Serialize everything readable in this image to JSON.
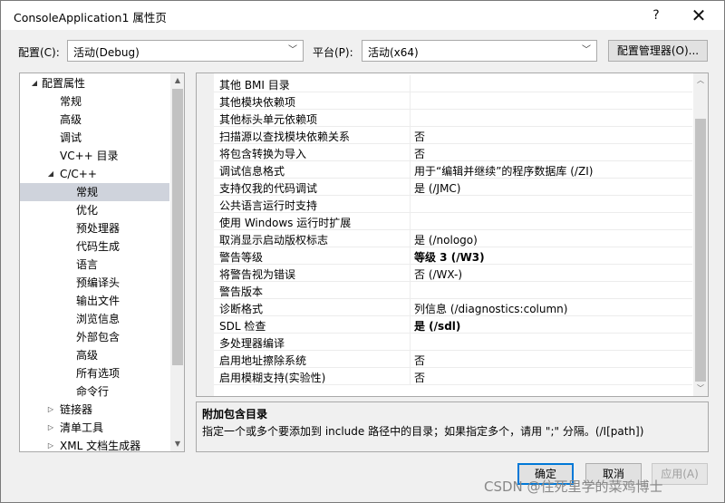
{
  "window": {
    "title": "ConsoleApplication1 属性页",
    "help": "?",
    "close": "✕"
  },
  "config": {
    "label": "配置(C):",
    "value": "活动(Debug)",
    "platform_label": "平台(P):",
    "platform_value": "活动(x64)",
    "manager_button": "配置管理器(O)..."
  },
  "tree": {
    "items": [
      {
        "label": "配置属性",
        "toggle": "◢"
      },
      {
        "label": "常规"
      },
      {
        "label": "高级"
      },
      {
        "label": "调试"
      },
      {
        "label": "VC++ 目录"
      },
      {
        "label": "C/C++",
        "toggle": "◢"
      },
      {
        "label": "常规"
      },
      {
        "label": "优化"
      },
      {
        "label": "预处理器"
      },
      {
        "label": "代码生成"
      },
      {
        "label": "语言"
      },
      {
        "label": "预编译头"
      },
      {
        "label": "输出文件"
      },
      {
        "label": "浏览信息"
      },
      {
        "label": "外部包含"
      },
      {
        "label": "高级"
      },
      {
        "label": "所有选项"
      },
      {
        "label": "命令行"
      },
      {
        "label": "链接器",
        "toggle": "▷"
      },
      {
        "label": "清单工具",
        "toggle": "▷"
      },
      {
        "label": "XML 文档生成器",
        "toggle": "▷"
      }
    ]
  },
  "properties": {
    "rows": [
      {
        "name": "其他 BMI 目录",
        "value": ""
      },
      {
        "name": "其他模块依赖项",
        "value": ""
      },
      {
        "name": "其他标头单元依赖项",
        "value": ""
      },
      {
        "name": "扫描源以查找模块依赖关系",
        "value": "否"
      },
      {
        "name": "将包含转换为导入",
        "value": "否"
      },
      {
        "name": "调试信息格式",
        "value": "用于“编辑并继续”的程序数据库 (/ZI)"
      },
      {
        "name": "支持仅我的代码调试",
        "value": "是 (/JMC)"
      },
      {
        "name": "公共语言运行时支持",
        "value": ""
      },
      {
        "name": "使用 Windows 运行时扩展",
        "value": ""
      },
      {
        "name": "取消显示启动版权标志",
        "value": "是 (/nologo)"
      },
      {
        "name": "警告等级",
        "value": "等级 3 (/W3)"
      },
      {
        "name": "将警告视为错误",
        "value": "否 (/WX-)"
      },
      {
        "name": "警告版本",
        "value": ""
      },
      {
        "name": "诊断格式",
        "value": "列信息 (/diagnostics:column)"
      },
      {
        "name": "SDL 检查",
        "value": "是 (/sdl)"
      },
      {
        "name": "多处理器编译",
        "value": ""
      },
      {
        "name": "启用地址擦除系统",
        "value": "否"
      },
      {
        "name": "启用模糊支持(实验性)",
        "value": "否"
      }
    ]
  },
  "description": {
    "title": "附加包含目录",
    "text": "指定一个或多个要添加到 include 路径中的目录；如果指定多个，请用 \";\" 分隔。(/I[path])"
  },
  "buttons": {
    "ok": "确定",
    "cancel": "取消",
    "apply": "应用(A)"
  },
  "watermark": "CSDN @住死里学的菜鸡博士"
}
